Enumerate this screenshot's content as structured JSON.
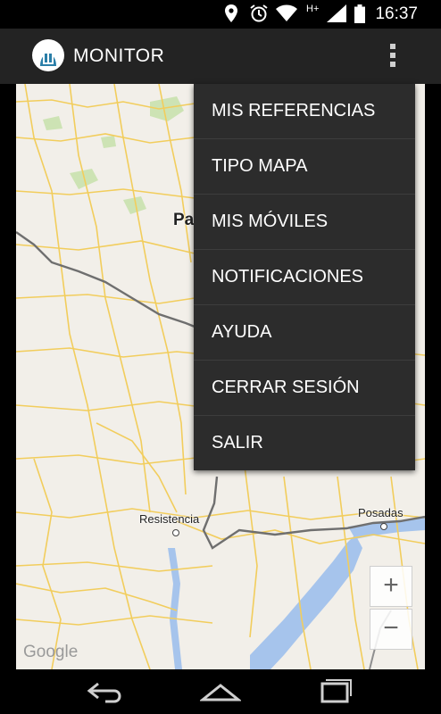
{
  "status_bar": {
    "time": "16:37",
    "network_type": "H+",
    "icons": [
      "location-icon",
      "alarm-icon",
      "wifi-icon",
      "signal-icon",
      "battery-icon"
    ]
  },
  "app": {
    "title": "MONITOR"
  },
  "menu": {
    "items": [
      {
        "label": "MIS REFERENCIAS"
      },
      {
        "label": "TIPO MAPA"
      },
      {
        "label": "MIS MÓVILES"
      },
      {
        "label": "NOTIFICACIONES"
      },
      {
        "label": "AYUDA"
      },
      {
        "label": "CERRAR SESIÓN"
      },
      {
        "label": "SALIR"
      }
    ]
  },
  "map": {
    "labels": {
      "pa_partial": "Pa",
      "resistencia": "Resistencia",
      "posadas": "Posadas"
    },
    "google": "Google",
    "zoom_in": "+",
    "zoom_out": "−"
  },
  "colors": {
    "action_bar": "#232323",
    "menu_bg": "#2c2c2c",
    "map_bg": "#f2efe9",
    "roads": "#f2cd5c",
    "water": "#a6c4ec",
    "border": "#6f6f6f",
    "park": "#cde3b4"
  }
}
